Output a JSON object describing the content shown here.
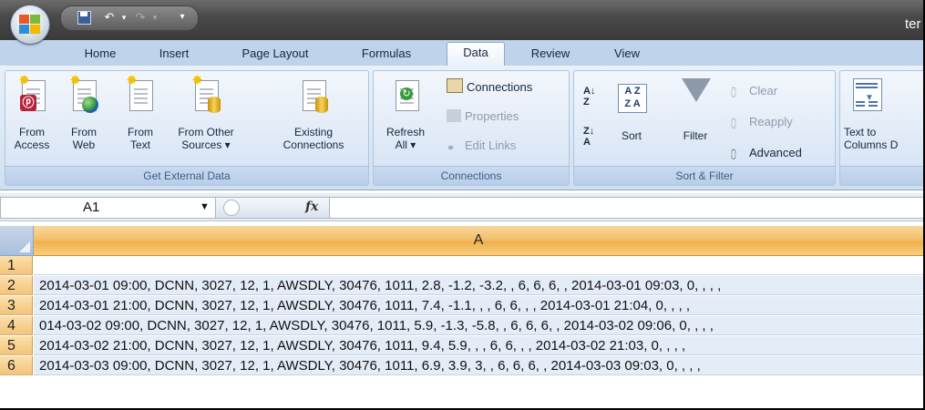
{
  "window": {
    "title": "ter"
  },
  "tabs": [
    {
      "label": "Home"
    },
    {
      "label": "Insert"
    },
    {
      "label": "Page Layout"
    },
    {
      "label": "Formulas"
    },
    {
      "label": "Data",
      "active": true
    },
    {
      "label": "Review"
    },
    {
      "label": "View"
    }
  ],
  "ribbon": {
    "get_external": {
      "label": "Get External Data",
      "from_access": [
        "From",
        "Access"
      ],
      "from_web": [
        "From",
        "Web"
      ],
      "from_text": [
        "From",
        "Text"
      ],
      "from_other": [
        "From Other",
        "Sources ▾"
      ],
      "existing": [
        "Existing",
        "Connections"
      ]
    },
    "connections": {
      "label": "Connections",
      "refresh": [
        "Refresh",
        "All ▾"
      ],
      "connections": "Connections",
      "properties": "Properties",
      "edit_links": "Edit Links"
    },
    "sort_filter": {
      "label": "Sort & Filter",
      "sort": "Sort",
      "filter": "Filter",
      "clear": "Clear",
      "reapply": "Reapply",
      "advanced": "Advanced"
    },
    "data_tools": {
      "text_to_columns": [
        "Text to",
        "Columns"
      ],
      "cut_letter": "D"
    }
  },
  "formula_bar": {
    "name_box": "A1",
    "fx": "fx",
    "formula": ""
  },
  "grid": {
    "column_header": "A",
    "rows": [
      {
        "num": "1",
        "a": ""
      },
      {
        "num": "2",
        "a": "2014-03-01 09:00, DCNN, 3027, 12, 1, AWSDLY, 30476, 1011, 2.8, -1.2, -3.2, , 6, 6, 6, , 2014-03-01 09:03, 0, , , ,"
      },
      {
        "num": "3",
        "a": "2014-03-01 21:00, DCNN, 3027, 12, 1, AWSDLY, 30476, 1011, 7.4, -1.1, , , 6, 6, , , 2014-03-01 21:04, 0, , , ,"
      },
      {
        "num": "4",
        "a": "014-03-02 09:00, DCNN, 3027, 12, 1, AWSDLY, 30476, 1011, 5.9, -1.3, -5.8, , 6, 6, 6, , 2014-03-02 09:06, 0, , , ,"
      },
      {
        "num": "5",
        "a": "2014-03-02 21:00, DCNN, 3027, 12, 1, AWSDLY, 30476, 1011, 9.4, 5.9, , , 6, 6, , , 2014-03-02 21:03, 0, , , ,"
      },
      {
        "num": "6",
        "a": "2014-03-03 09:00, DCNN, 3027, 12, 1, AWSDLY, 30476, 1011, 6.9, 3.9, 3, , 6, 6, 6, , 2014-03-03 09:03, 0, , , ,"
      }
    ]
  }
}
